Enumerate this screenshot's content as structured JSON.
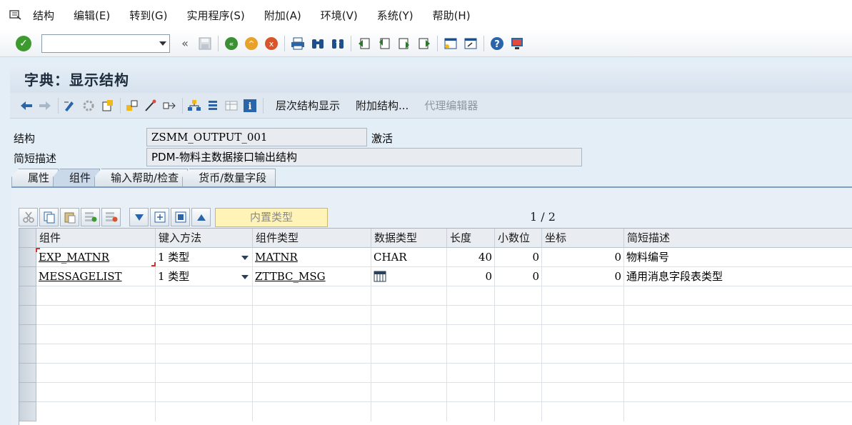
{
  "menubar": {
    "items": [
      "结构",
      "编辑(E)",
      "转到(G)",
      "实用程序(S)",
      "附加(A)",
      "环境(V)",
      "系统(Y)",
      "帮助(H)"
    ]
  },
  "systoolbar": {
    "command_value": ""
  },
  "title": "字典：显示结构",
  "apptoolbar": {
    "buttons": [
      "层次结构显示",
      "附加结构...",
      "代理编辑器"
    ]
  },
  "header": {
    "structure_label": "结构",
    "structure_value": "ZSMM_OUTPUT_001",
    "structure_status": "激活",
    "desc_label": "简短描述",
    "desc_value": "PDM-物料主数据接口输出结构"
  },
  "tabs": [
    "属性",
    "组件",
    "输入帮助/检查",
    "货币/数量字段"
  ],
  "active_tab": "组件",
  "table_toolbar": {
    "builtin_type_label": "内置类型",
    "page_indicator": "1 / 2"
  },
  "table": {
    "columns": [
      "组件",
      "键入方法",
      "组件类型",
      "数据类型",
      "长度",
      "小数位",
      "坐标",
      "简短描述"
    ],
    "rows": [
      {
        "component": "EXP_MATNR",
        "typing": "1 类型",
        "comp_type": "MATNR",
        "data_type": "CHAR",
        "length": "40",
        "decimals": "0",
        "coord": "0",
        "desc": "物料编号"
      },
      {
        "component": "MESSAGELIST",
        "typing": "1 类型",
        "comp_type": "ZTTBC_MSG",
        "data_type": "",
        "length": "0",
        "decimals": "0",
        "coord": "0",
        "desc": "通用消息字段表类型"
      }
    ]
  },
  "colors": {
    "accent": "#7f9fc2",
    "enter_green": "#3c9a2e",
    "builtin_yellow": "#fff3b8"
  }
}
